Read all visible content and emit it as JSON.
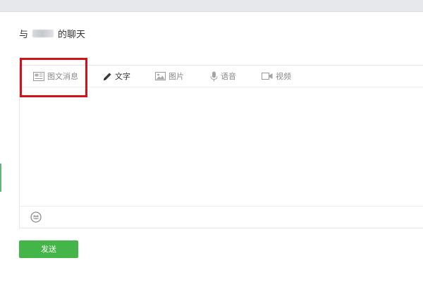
{
  "chat_header": {
    "prefix": "与",
    "suffix": "的聊天"
  },
  "tabs": [
    {
      "label": "图文消息",
      "icon": "news-card-icon"
    },
    {
      "label": "文字",
      "icon": "pencil-icon"
    },
    {
      "label": "图片",
      "icon": "image-icon"
    },
    {
      "label": "语音",
      "icon": "microphone-icon"
    },
    {
      "label": "视频",
      "icon": "video-camera-icon"
    }
  ],
  "actions": {
    "send_label": "发送"
  },
  "colors": {
    "send_button": "#44b549",
    "highlight": "#d0131a",
    "top_strip": "#e7e8eb"
  }
}
